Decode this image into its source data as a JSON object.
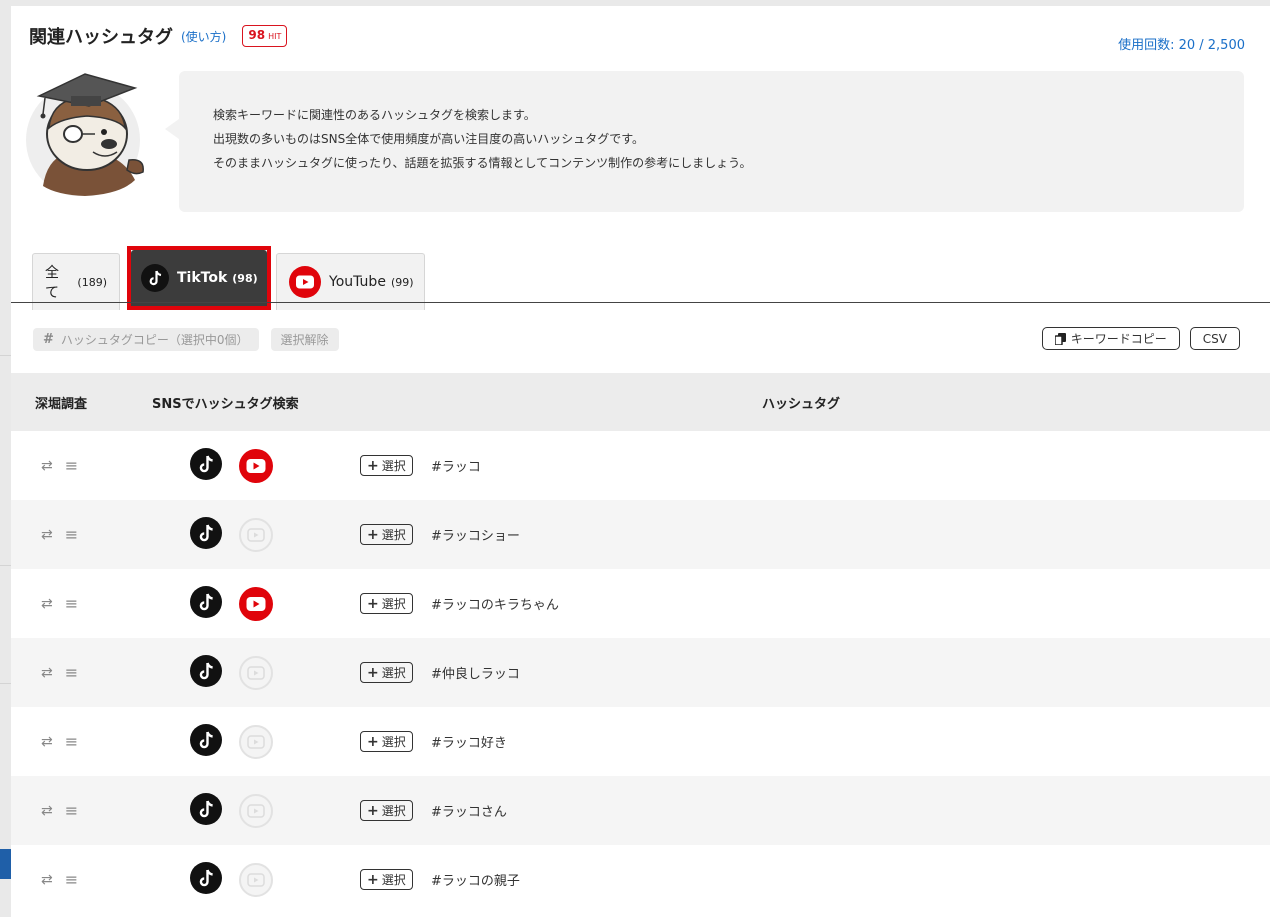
{
  "header": {
    "title": "関連ハッシュタグ",
    "howto": "(使い方)",
    "hit_count": "98",
    "hit_unit": "HIT",
    "usage": "使用回数: 20 / 2,500"
  },
  "description": [
    "検索キーワードに関連性のあるハッシュタグを検索します。",
    "出現数の多いものはSNS全体で使用頻度が高い注目度の高いハッシュタグです。",
    "そのままハッシュタグに使ったり、話題を拡張する情報としてコンテンツ制作の参考にしましょう。"
  ],
  "tabs": [
    {
      "label": "全て",
      "count": "(189)"
    },
    {
      "label": "TikTok",
      "count": "(98)",
      "icon": "tiktok-icon",
      "active": true
    },
    {
      "label": "YouTube",
      "count": "(99)",
      "icon": "youtube-icon"
    }
  ],
  "toolbar": {
    "hash_symbol": "#",
    "copy_selected": "ハッシュタグコピー（選択中0個）",
    "deselect": "選択解除",
    "keyword_copy": "キーワードコピー",
    "csv": "CSV"
  },
  "table": {
    "headers": {
      "deep": "深堀調査",
      "sns": "SNSでハッシュタグ検索",
      "tag": "ハッシュタグ"
    },
    "select_label": "選択",
    "rows": [
      {
        "tag": "#ラッコ",
        "youtube_active": true
      },
      {
        "tag": "#ラッコショー",
        "youtube_active": false
      },
      {
        "tag": "#ラッコのキラちゃん",
        "youtube_active": true
      },
      {
        "tag": "#仲良しラッコ",
        "youtube_active": false
      },
      {
        "tag": "#ラッコ好き",
        "youtube_active": false
      },
      {
        "tag": "#ラッコさん",
        "youtube_active": false
      },
      {
        "tag": "#ラッコの親子",
        "youtube_active": false
      }
    ]
  },
  "colors": {
    "accent_red": "#e0040b",
    "link_blue": "#1a6fc8",
    "tab_active_bg": "#3c3c3c"
  }
}
